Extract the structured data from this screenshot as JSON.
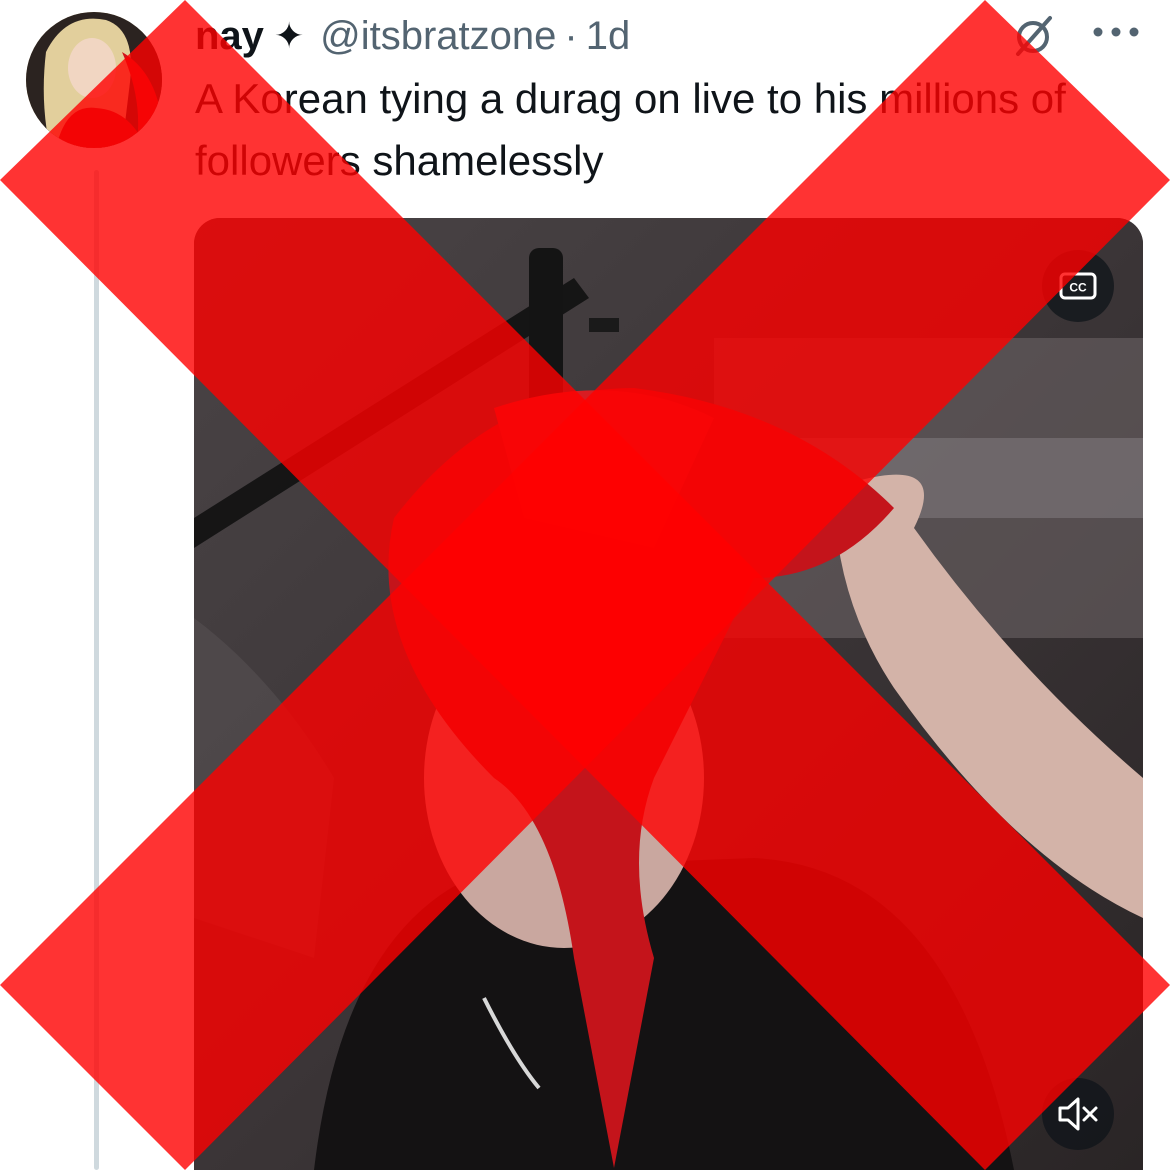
{
  "post": {
    "author_name": "nay",
    "author_badge": "✦",
    "handle": "@itsbratzone",
    "separator": "·",
    "timestamp": "1d",
    "text": "A Korean tying a durag on live to his millions of followers shamelessly"
  },
  "media": {
    "type": "video",
    "cc_icon": "closed-captions-icon",
    "mute_icon": "muted-speaker-icon"
  },
  "icons": {
    "grok": "grok-icon",
    "more": "more-options-icon"
  },
  "overlay": {
    "shape": "red-x",
    "color": "#ff0000"
  },
  "colors": {
    "text_primary": "#0f1419",
    "text_secondary": "#536471",
    "thread_line": "#cfd9de"
  }
}
